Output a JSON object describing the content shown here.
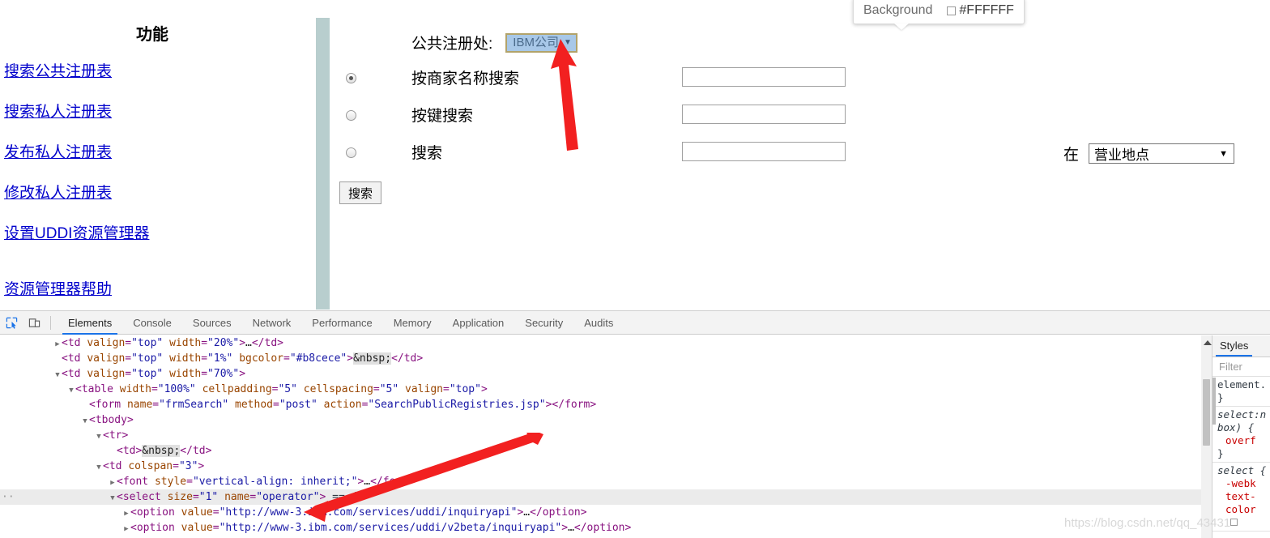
{
  "page": {
    "sidebar": {
      "title": "功能",
      "links": [
        "搜索公共注册表",
        "搜索私人注册表",
        "发布私人注册表",
        "修改私人注册表",
        "设置UDDI资源管理器"
      ],
      "help_link": "资源管理器帮助"
    },
    "divider_color": "#b8cece",
    "form": {
      "registry_label": "公共注册处:",
      "registry_selected": "IBM公司",
      "dropdown_arrow": "▼",
      "rows": [
        {
          "label": "按商家名称搜索",
          "checked": true,
          "value": ""
        },
        {
          "label": "按键搜索",
          "checked": false,
          "value": ""
        },
        {
          "label": "搜索",
          "checked": false,
          "value": ""
        }
      ],
      "submit_label": "搜索",
      "location_prefix": "在",
      "location_selected": "营业地点",
      "location_arrow": "▼"
    },
    "tooltip": {
      "property": "Background",
      "value": "#FFFFFF",
      "swatch_color": "#FFFFFF"
    }
  },
  "devtools": {
    "toolbar": {
      "inspect_icon": "inspect-element-icon",
      "device_icon": "device-toolbar-icon",
      "tabs": [
        {
          "label": "Elements",
          "active": true
        },
        {
          "label": "Console",
          "active": false
        },
        {
          "label": "Sources",
          "active": false
        },
        {
          "label": "Network",
          "active": false
        },
        {
          "label": "Performance",
          "active": false
        },
        {
          "label": "Memory",
          "active": false
        },
        {
          "label": "Application",
          "active": false
        },
        {
          "label": "Security",
          "active": false
        },
        {
          "label": "Audits",
          "active": false
        }
      ]
    },
    "dom_lines": [
      {
        "indent": 0,
        "tri": "▶",
        "selected": false,
        "gutter": "",
        "parts": [
          {
            "t": "punct",
            "v": "<"
          },
          {
            "t": "tagname",
            "v": "td"
          },
          {
            "t": "sp",
            "v": " "
          },
          {
            "t": "attrname",
            "v": "valign"
          },
          {
            "t": "punct",
            "v": "="
          },
          {
            "t": "attrval",
            "v": "\"top\""
          },
          {
            "t": "sp",
            "v": " "
          },
          {
            "t": "attrname",
            "v": "width"
          },
          {
            "t": "punct",
            "v": "="
          },
          {
            "t": "attrval",
            "v": "\"20%\""
          },
          {
            "t": "punct",
            "v": ">"
          },
          {
            "t": "txt",
            "v": "…"
          },
          {
            "t": "punct",
            "v": "</"
          },
          {
            "t": "tagname",
            "v": "td"
          },
          {
            "t": "punct",
            "v": ">"
          }
        ]
      },
      {
        "indent": 0,
        "tri": "",
        "selected": false,
        "gutter": "",
        "parts": [
          {
            "t": "punct",
            "v": "<"
          },
          {
            "t": "tagname",
            "v": "td"
          },
          {
            "t": "sp",
            "v": " "
          },
          {
            "t": "attrname",
            "v": "valign"
          },
          {
            "t": "punct",
            "v": "="
          },
          {
            "t": "attrval",
            "v": "\"top\""
          },
          {
            "t": "sp",
            "v": " "
          },
          {
            "t": "attrname",
            "v": "width"
          },
          {
            "t": "punct",
            "v": "="
          },
          {
            "t": "attrval",
            "v": "\"1%\""
          },
          {
            "t": "sp",
            "v": " "
          },
          {
            "t": "attrname",
            "v": "bgcolor"
          },
          {
            "t": "punct",
            "v": "="
          },
          {
            "t": "attrval",
            "v": "\"#b8cece\""
          },
          {
            "t": "punct",
            "v": ">"
          },
          {
            "t": "nbsp",
            "v": "&nbsp;"
          },
          {
            "t": "punct",
            "v": "</"
          },
          {
            "t": "tagname",
            "v": "td"
          },
          {
            "t": "punct",
            "v": ">"
          }
        ]
      },
      {
        "indent": 0,
        "tri": "▼",
        "selected": false,
        "gutter": "",
        "parts": [
          {
            "t": "punct",
            "v": "<"
          },
          {
            "t": "tagname",
            "v": "td"
          },
          {
            "t": "sp",
            "v": " "
          },
          {
            "t": "attrname",
            "v": "valign"
          },
          {
            "t": "punct",
            "v": "="
          },
          {
            "t": "attrval",
            "v": "\"top\""
          },
          {
            "t": "sp",
            "v": " "
          },
          {
            "t": "attrname",
            "v": "width"
          },
          {
            "t": "punct",
            "v": "="
          },
          {
            "t": "attrval",
            "v": "\"70%\""
          },
          {
            "t": "punct",
            "v": ">"
          }
        ]
      },
      {
        "indent": 1,
        "tri": "▼",
        "selected": false,
        "gutter": "",
        "parts": [
          {
            "t": "punct",
            "v": "<"
          },
          {
            "t": "tagname",
            "v": "table"
          },
          {
            "t": "sp",
            "v": " "
          },
          {
            "t": "attrname",
            "v": "width"
          },
          {
            "t": "punct",
            "v": "="
          },
          {
            "t": "attrval",
            "v": "\"100%\""
          },
          {
            "t": "sp",
            "v": " "
          },
          {
            "t": "attrname",
            "v": "cellpadding"
          },
          {
            "t": "punct",
            "v": "="
          },
          {
            "t": "attrval",
            "v": "\"5\""
          },
          {
            "t": "sp",
            "v": " "
          },
          {
            "t": "attrname",
            "v": "cellspacing"
          },
          {
            "t": "punct",
            "v": "="
          },
          {
            "t": "attrval",
            "v": "\"5\""
          },
          {
            "t": "sp",
            "v": " "
          },
          {
            "t": "attrname",
            "v": "valign"
          },
          {
            "t": "punct",
            "v": "="
          },
          {
            "t": "attrval",
            "v": "\"top\""
          },
          {
            "t": "punct",
            "v": ">"
          }
        ]
      },
      {
        "indent": 2,
        "tri": "",
        "selected": false,
        "gutter": "",
        "parts": [
          {
            "t": "punct",
            "v": "<"
          },
          {
            "t": "tagname",
            "v": "form"
          },
          {
            "t": "sp",
            "v": " "
          },
          {
            "t": "attrname",
            "v": "name"
          },
          {
            "t": "punct",
            "v": "="
          },
          {
            "t": "attrval",
            "v": "\"frmSearch\""
          },
          {
            "t": "sp",
            "v": " "
          },
          {
            "t": "attrname",
            "v": "method"
          },
          {
            "t": "punct",
            "v": "="
          },
          {
            "t": "attrval",
            "v": "\"post\""
          },
          {
            "t": "sp",
            "v": " "
          },
          {
            "t": "attrname",
            "v": "action"
          },
          {
            "t": "punct",
            "v": "="
          },
          {
            "t": "attrval",
            "v": "\"SearchPublicRegistries.jsp\""
          },
          {
            "t": "punct",
            "v": "></"
          },
          {
            "t": "tagname",
            "v": "form"
          },
          {
            "t": "punct",
            "v": ">"
          }
        ]
      },
      {
        "indent": 2,
        "tri": "▼",
        "selected": false,
        "gutter": "",
        "parts": [
          {
            "t": "punct",
            "v": "<"
          },
          {
            "t": "tagname",
            "v": "tbody"
          },
          {
            "t": "punct",
            "v": ">"
          }
        ]
      },
      {
        "indent": 3,
        "tri": "▼",
        "selected": false,
        "gutter": "",
        "parts": [
          {
            "t": "punct",
            "v": "<"
          },
          {
            "t": "tagname",
            "v": "tr"
          },
          {
            "t": "punct",
            "v": ">"
          }
        ]
      },
      {
        "indent": 4,
        "tri": "",
        "selected": false,
        "gutter": "",
        "parts": [
          {
            "t": "punct",
            "v": "<"
          },
          {
            "t": "tagname",
            "v": "td"
          },
          {
            "t": "punct",
            "v": ">"
          },
          {
            "t": "nbsp",
            "v": "&nbsp;"
          },
          {
            "t": "punct",
            "v": "</"
          },
          {
            "t": "tagname",
            "v": "td"
          },
          {
            "t": "punct",
            "v": ">"
          }
        ]
      },
      {
        "indent": 3,
        "tri": "▼",
        "selected": false,
        "gutter": "",
        "parts": [
          {
            "t": "punct",
            "v": "<"
          },
          {
            "t": "tagname",
            "v": "td"
          },
          {
            "t": "sp",
            "v": " "
          },
          {
            "t": "attrname",
            "v": "colspan"
          },
          {
            "t": "punct",
            "v": "="
          },
          {
            "t": "attrval",
            "v": "\"3\""
          },
          {
            "t": "punct",
            "v": ">"
          }
        ]
      },
      {
        "indent": 4,
        "tri": "▶",
        "selected": false,
        "gutter": "",
        "parts": [
          {
            "t": "punct",
            "v": "<"
          },
          {
            "t": "tagname",
            "v": "font"
          },
          {
            "t": "sp",
            "v": " "
          },
          {
            "t": "attrname",
            "v": "style"
          },
          {
            "t": "punct",
            "v": "="
          },
          {
            "t": "attrval",
            "v": "\"vertical-align: inherit;\""
          },
          {
            "t": "punct",
            "v": ">"
          },
          {
            "t": "txt",
            "v": "…"
          },
          {
            "t": "punct",
            "v": "</"
          },
          {
            "t": "tagname",
            "v": "font"
          },
          {
            "t": "punct",
            "v": ">"
          }
        ]
      },
      {
        "indent": 4,
        "tri": "▼",
        "selected": true,
        "gutter": "··",
        "parts": [
          {
            "t": "punct",
            "v": "<"
          },
          {
            "t": "tagname",
            "v": "select"
          },
          {
            "t": "sp",
            "v": " "
          },
          {
            "t": "attrname",
            "v": "size"
          },
          {
            "t": "punct",
            "v": "="
          },
          {
            "t": "attrval",
            "v": "\"1\""
          },
          {
            "t": "sp",
            "v": " "
          },
          {
            "t": "attrname",
            "v": "name"
          },
          {
            "t": "punct",
            "v": "="
          },
          {
            "t": "attrval",
            "v": "\"operator\""
          },
          {
            "t": "punct",
            "v": ">"
          },
          {
            "t": "sp",
            "v": " "
          },
          {
            "t": "ref",
            "v": "== $0"
          }
        ]
      },
      {
        "indent": 5,
        "tri": "▶",
        "selected": false,
        "gutter": "",
        "parts": [
          {
            "t": "punct",
            "v": "<"
          },
          {
            "t": "tagname",
            "v": "option"
          },
          {
            "t": "sp",
            "v": " "
          },
          {
            "t": "attrname",
            "v": "value"
          },
          {
            "t": "punct",
            "v": "="
          },
          {
            "t": "attrval",
            "v": "\"http://www-3.ibm.com/services/uddi/inquiryapi\""
          },
          {
            "t": "punct",
            "v": ">"
          },
          {
            "t": "txt",
            "v": "…"
          },
          {
            "t": "punct",
            "v": "</"
          },
          {
            "t": "tagname",
            "v": "option"
          },
          {
            "t": "punct",
            "v": ">"
          }
        ]
      },
      {
        "indent": 5,
        "tri": "▶",
        "selected": false,
        "gutter": "",
        "parts": [
          {
            "t": "punct",
            "v": "<"
          },
          {
            "t": "tagname",
            "v": "option"
          },
          {
            "t": "sp",
            "v": " "
          },
          {
            "t": "attrname",
            "v": "value"
          },
          {
            "t": "punct",
            "v": "="
          },
          {
            "t": "attrval",
            "v": "\"http://www-3.ibm.com/services/uddi/v2beta/inquiryapi\""
          },
          {
            "t": "punct",
            "v": ">"
          },
          {
            "t": "txt",
            "v": "…"
          },
          {
            "t": "punct",
            "v": "</"
          },
          {
            "t": "tagname",
            "v": "option"
          },
          {
            "t": "punct",
            "v": ">"
          }
        ]
      }
    ],
    "styles": {
      "tab_label": "Styles",
      "filter_placeholder": "Filter",
      "blocks": [
        {
          "selector": "element.",
          "ua": false,
          "props": [],
          "close": "}"
        },
        {
          "selector": "select:n",
          "ua": true,
          "props": [
            "overf"
          ],
          "close": "}",
          "extra": "box) {"
        },
        {
          "selector": "select {",
          "ua": true,
          "props": [
            "-webk",
            "text-",
            "color"
          ],
          "close": "",
          "checkbox": true
        }
      ]
    }
  },
  "watermark": "https://blog.csdn.net/qq_43431"
}
